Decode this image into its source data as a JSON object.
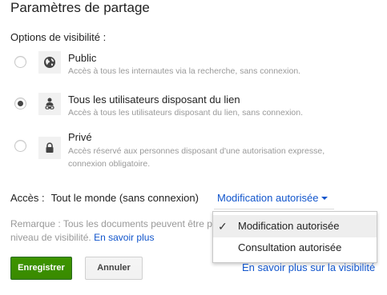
{
  "dialog": {
    "title": "Paramètres de partage",
    "visibility_label": "Options de visibilité :"
  },
  "options": [
    {
      "title": "Public",
      "desc": "Accès à tous les internautes via la recherche, sans connexion.",
      "icon": "globe-icon",
      "selected": false
    },
    {
      "title": "Tous les utilisateurs disposant du lien",
      "desc": "Accès à tous les utilisateurs disposant du lien, sans connexion.",
      "icon": "person-link-icon",
      "selected": true
    },
    {
      "title": "Privé",
      "desc_line1": "Accès réservé aux personnes disposant d'une autorisation expresse,",
      "desc_line2": "connexion obligatoire.",
      "icon": "lock-icon",
      "selected": false
    }
  ],
  "access": {
    "label": "Accès :",
    "value": "Tout le monde (sans connexion)",
    "dropdown_value": "Modification autorisée"
  },
  "remark": {
    "text_line1": "Remarque : Tous les documents peuvent être p",
    "text_line2": "niveau de visibilité.",
    "link": "En savoir plus"
  },
  "menu": {
    "items": [
      {
        "label": "Modification autorisée",
        "checked": true
      },
      {
        "label": "Consultation autorisée",
        "checked": false
      }
    ]
  },
  "buttons": {
    "save": "Enregistrer",
    "cancel": "Annuler"
  },
  "footer_link": "En savoir plus sur la visibilité",
  "colors": {
    "link": "#1155cc",
    "primary_button": "#3d9400",
    "muted_text": "#999999"
  }
}
